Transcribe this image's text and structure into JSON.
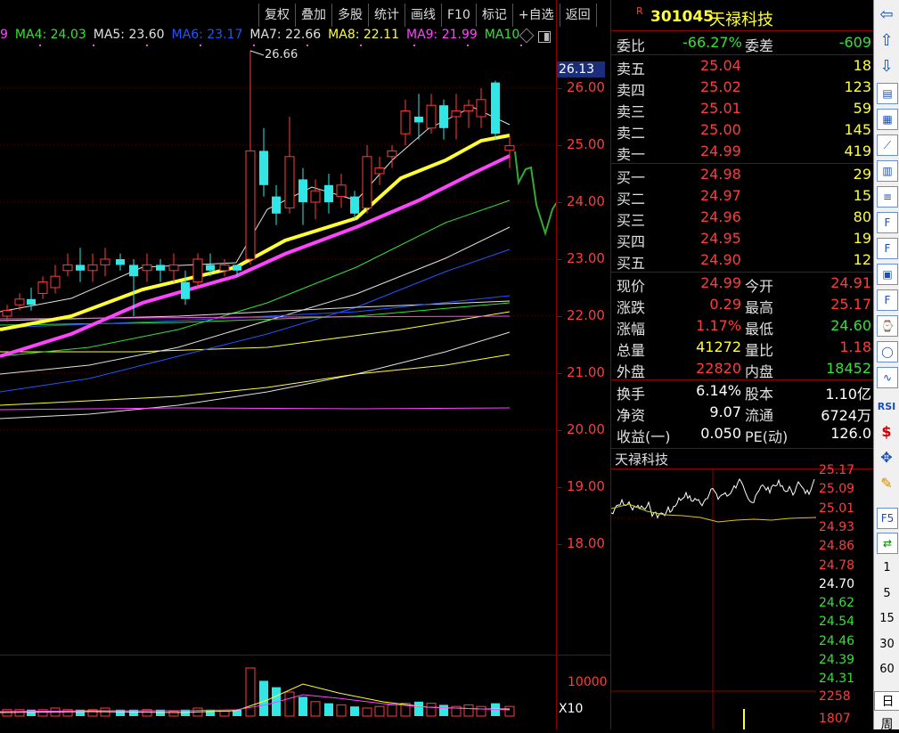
{
  "toolbar": {
    "items": [
      "复权",
      "叠加",
      "多股",
      "统计",
      "画线",
      "F10",
      "标记",
      "+自选",
      "返回"
    ]
  },
  "ma_legend": [
    {
      "text": "9",
      "color": "#ff44ff"
    },
    {
      "text": "MA4: 24.03",
      "color": "#33e233"
    },
    {
      "text": "MA5: 23.60",
      "color": "#e0e0e0"
    },
    {
      "text": "MA6: 23.17",
      "color": "#2255ff"
    },
    {
      "text": "MA7: 22.66",
      "color": "#e0e0e0"
    },
    {
      "text": "MA8: 22.11",
      "color": "#ffff33"
    },
    {
      "text": "MA9: 21.99",
      "color": "#ff44ff"
    },
    {
      "text": "MA10",
      "color": "#33e233"
    }
  ],
  "chart_annotation": "26.66",
  "price_axis": {
    "current_tag": "26.13",
    "labels": [
      "26.00",
      "25.00",
      "24.00",
      "23.00",
      "22.00",
      "21.00",
      "20.00",
      "19.00",
      "18.00"
    ]
  },
  "volume_axis": {
    "label": "10000",
    "unit": "X10"
  },
  "stock": {
    "badge": "R",
    "code": "301045",
    "name": "天禄科技"
  },
  "weibi": {
    "label": "委比",
    "value": "-66.27%",
    "label2": "委差",
    "value2": "-609"
  },
  "asks": [
    {
      "label": "卖五",
      "price": "25.04",
      "vol": "18"
    },
    {
      "label": "卖四",
      "price": "25.02",
      "vol": "123"
    },
    {
      "label": "卖三",
      "price": "25.01",
      "vol": "59"
    },
    {
      "label": "卖二",
      "price": "25.00",
      "vol": "145"
    },
    {
      "label": "卖一",
      "price": "24.99",
      "vol": "419"
    }
  ],
  "bids": [
    {
      "label": "买一",
      "price": "24.98",
      "vol": "29"
    },
    {
      "label": "买二",
      "price": "24.97",
      "vol": "15"
    },
    {
      "label": "买三",
      "price": "24.96",
      "vol": "80"
    },
    {
      "label": "买四",
      "price": "24.95",
      "vol": "19"
    },
    {
      "label": "买五",
      "price": "24.90",
      "vol": "12"
    }
  ],
  "quote": [
    {
      "l1": "现价",
      "v1": "24.99",
      "c1": "red",
      "l2": "今开",
      "v2": "24.91",
      "c2": "red"
    },
    {
      "l1": "涨跌",
      "v1": "0.29",
      "c1": "red",
      "l2": "最高",
      "v2": "25.17",
      "c2": "red"
    },
    {
      "l1": "涨幅",
      "v1": "1.17%",
      "c1": "red",
      "l2": "最低",
      "v2": "24.60",
      "c2": "green"
    },
    {
      "l1": "总量",
      "v1": "41272",
      "c1": "yellow",
      "l2": "量比",
      "v2": "1.18",
      "c2": "red"
    },
    {
      "l1": "外盘",
      "v1": "22820",
      "c1": "red",
      "l2": "内盘",
      "v2": "18452",
      "c2": "green"
    }
  ],
  "fundamentals": [
    {
      "l1": "换手",
      "v1": "6.14%",
      "l2": "股本",
      "v2": "1.10亿"
    },
    {
      "l1": "净资",
      "v1": "9.07",
      "l2": "流通",
      "v2": "6724万"
    },
    {
      "l1": "收益(一)",
      "v1": "0.050",
      "l2": "PE(动)",
      "v2": "126.0"
    }
  ],
  "intraday": {
    "title": "天禄科技",
    "price_labels": [
      {
        "t": "25.17",
        "c": "red"
      },
      {
        "t": "25.09",
        "c": "red"
      },
      {
        "t": "25.01",
        "c": "red"
      },
      {
        "t": "24.93",
        "c": "red"
      },
      {
        "t": "24.86",
        "c": "red"
      },
      {
        "t": "24.78",
        "c": "red"
      },
      {
        "t": "24.70",
        "c": "white"
      },
      {
        "t": "24.62",
        "c": "green"
      },
      {
        "t": "24.54",
        "c": "green"
      },
      {
        "t": "24.46",
        "c": "green"
      },
      {
        "t": "24.39",
        "c": "green"
      },
      {
        "t": "24.31",
        "c": "green"
      }
    ],
    "vol_labels": [
      "2258",
      "1807"
    ]
  },
  "side_toolbar": {
    "icons": [
      "left-arrow-icon",
      "up-arrow-icon",
      "down-arrow-icon",
      "notebook-icon",
      "grid-icon",
      "line-chart-icon",
      "candle-icon",
      "list-icon",
      "f10-icon",
      "f-icon",
      "bookmark-icon",
      "f12-icon",
      "clock-icon",
      "circle-icon",
      "wave-icon"
    ],
    "rsi": "RSI",
    "numbers": [
      "1",
      "5",
      "15",
      "30",
      "60"
    ],
    "periods": [
      "日",
      "周"
    ]
  },
  "colors": {
    "up": "#ff3b3b",
    "down": "#33e6e6",
    "bg": "#000000"
  }
}
